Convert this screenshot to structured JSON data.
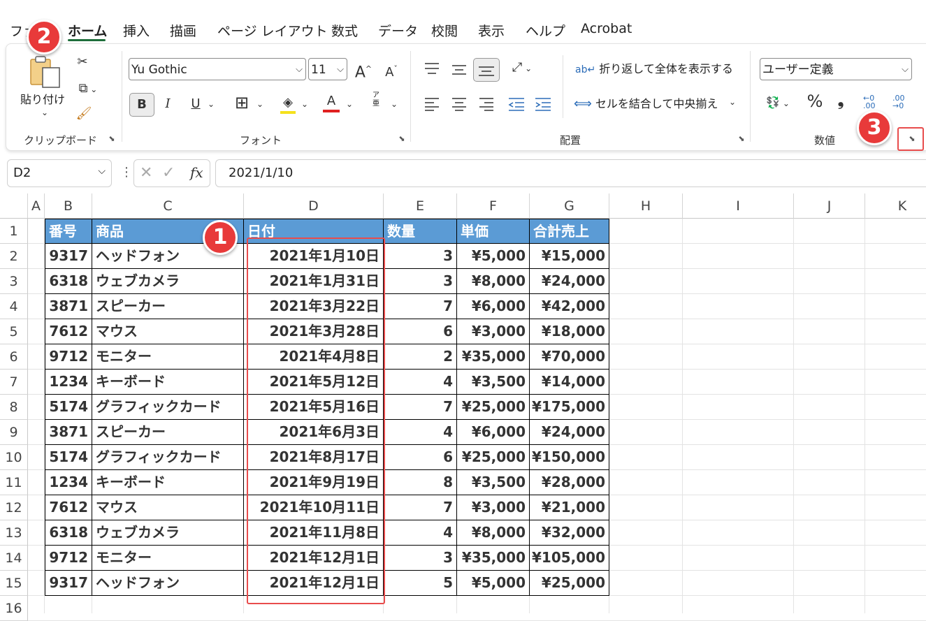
{
  "ribbon_tabs": [
    "ファイル",
    "ホーム",
    "挿入",
    "描画",
    "ページ レイアウト",
    "数式",
    "データ",
    "校閲",
    "表示",
    "ヘルプ",
    "Acrobat"
  ],
  "clipboard": {
    "paste_label": "貼り付け",
    "group_label": "クリップボード"
  },
  "font": {
    "name": "Yu Gothic",
    "size": "11",
    "group_label": "フォント",
    "bold": "B",
    "italic": "I",
    "underline": "U",
    "grow": "A",
    "shrink": "A",
    "phonetic_top": "ア",
    "phonetic_bottom": "亜",
    "font_color_letter": "A"
  },
  "alignment": {
    "wrap_label": "折り返して全体を表示する",
    "merge_label": "セルを結合して中央揃え",
    "group_label": "配置"
  },
  "number": {
    "format": "ユーザー定義",
    "group_label": "数値",
    "percent": "%",
    "comma": "❟"
  },
  "formula_bar": {
    "name_box": "D2",
    "fx": "fx",
    "value": "2021/1/10"
  },
  "columns": [
    "A",
    "B",
    "C",
    "D",
    "E",
    "F",
    "G",
    "H",
    "I",
    "J",
    "K"
  ],
  "rows": [
    "1",
    "2",
    "3",
    "4",
    "5",
    "6",
    "7",
    "8",
    "9",
    "10",
    "11",
    "12",
    "13",
    "14",
    "15",
    "16"
  ],
  "table": {
    "headers": [
      "番号",
      "商品",
      "日付",
      "数量",
      "単価",
      "合計売上"
    ],
    "rows": [
      [
        "9317",
        "ヘッドフォン",
        "2021年1月10日",
        "3",
        "¥5,000",
        "¥15,000"
      ],
      [
        "6318",
        "ウェブカメラ",
        "2021年1月31日",
        "3",
        "¥8,000",
        "¥24,000"
      ],
      [
        "3871",
        "スピーカー",
        "2021年3月22日",
        "7",
        "¥6,000",
        "¥42,000"
      ],
      [
        "7612",
        "マウス",
        "2021年3月28日",
        "6",
        "¥3,000",
        "¥18,000"
      ],
      [
        "9712",
        "モニター",
        "2021年4月8日",
        "2",
        "¥35,000",
        "¥70,000"
      ],
      [
        "1234",
        "キーボード",
        "2021年5月12日",
        "4",
        "¥3,500",
        "¥14,000"
      ],
      [
        "5174",
        "グラフィックカード",
        "2021年5月16日",
        "7",
        "¥25,000",
        "¥175,000"
      ],
      [
        "3871",
        "スピーカー",
        "2021年6月3日",
        "4",
        "¥6,000",
        "¥24,000"
      ],
      [
        "5174",
        "グラフィックカード",
        "2021年8月17日",
        "6",
        "¥25,000",
        "¥150,000"
      ],
      [
        "1234",
        "キーボード",
        "2021年9月19日",
        "8",
        "¥3,500",
        "¥28,000"
      ],
      [
        "7612",
        "マウス",
        "2021年10月11日",
        "7",
        "¥3,000",
        "¥21,000"
      ],
      [
        "6318",
        "ウェブカメラ",
        "2021年11月8日",
        "4",
        "¥8,000",
        "¥32,000"
      ],
      [
        "9712",
        "モニター",
        "2021年12月1日",
        "3",
        "¥35,000",
        "¥105,000"
      ],
      [
        "9317",
        "ヘッドフォン",
        "2021年12月1日",
        "5",
        "¥5,000",
        "¥25,000"
      ]
    ]
  },
  "annotations": [
    "1",
    "2",
    "3"
  ],
  "colors": {
    "header_fill": "#5b9bd5",
    "annotation_red": "#e83a3a",
    "active_tab_underline": "#1e6e3a"
  }
}
